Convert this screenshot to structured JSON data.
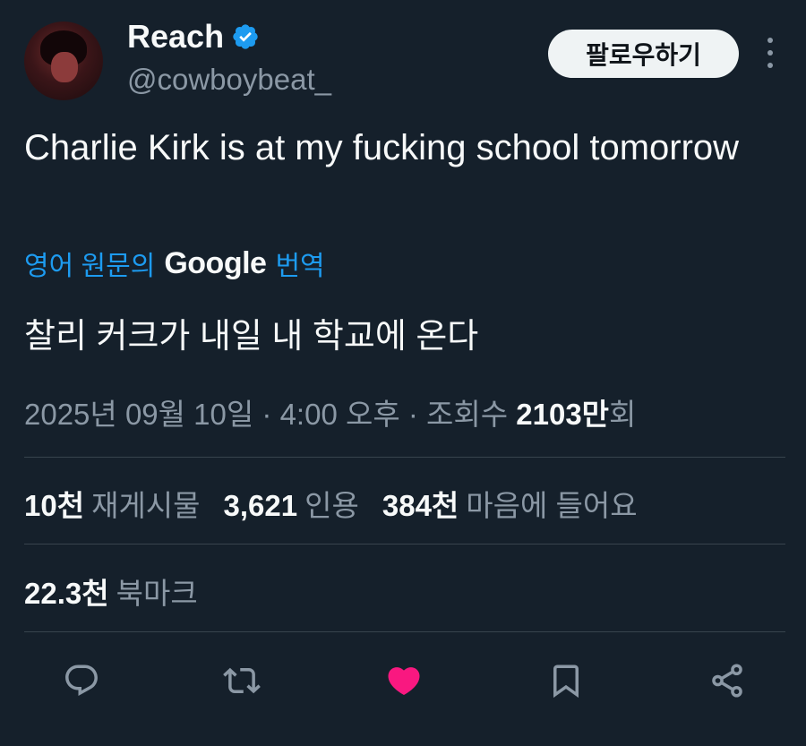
{
  "author": {
    "display_name": "Reach",
    "handle": "@cowboybeat_",
    "verified_icon": "verified-badge-icon"
  },
  "header": {
    "follow_label": "팔로우하기",
    "more_icon": "more-vertical-icon"
  },
  "tweet": {
    "text": "Charlie Kirk is at my fucking school tomorrow"
  },
  "translation": {
    "prefix": "영어 원문의",
    "brand": "Google",
    "suffix": "번역",
    "text": "찰리 커크가 내일 내 학교에 온다"
  },
  "meta": {
    "timestamp": "2025년 09월 10일 · 4:00 오후 · 조회수",
    "views_bold": "2103만",
    "views_suffix": "회"
  },
  "stats": {
    "reposts_num": "10천",
    "reposts_label": "재게시물",
    "quotes_num": "3,621",
    "quotes_label": "인용",
    "likes_num": "384천",
    "likes_label": "마음에 들어요",
    "bookmarks_num": "22.3천",
    "bookmarks_label": "북마크"
  },
  "actions": {
    "reply_icon": "reply-icon",
    "repost_icon": "repost-icon",
    "like_icon": "heart-icon",
    "bookmark_icon": "bookmark-icon",
    "share_icon": "share-icon"
  },
  "colors": {
    "background": "#15202b",
    "accent": "#1d9bf0",
    "like": "#f91880",
    "muted": "#8b98a5"
  }
}
